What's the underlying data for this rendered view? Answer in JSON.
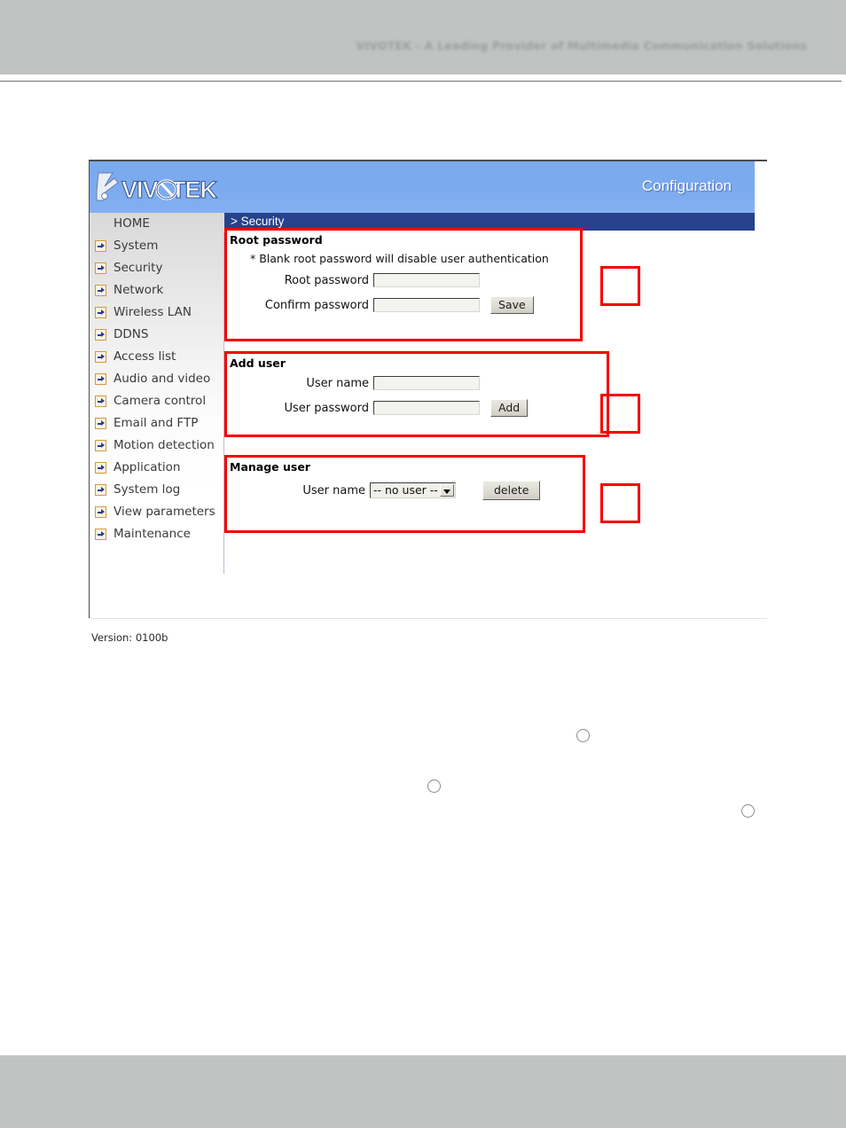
{
  "page": {
    "top_tagline": "VIVOTEK - A Leading Provider of Multimedia Communication Solutions"
  },
  "banner": {
    "brand": "VIVOTEK",
    "title": "Configuration"
  },
  "page_title": "> Security",
  "sidebar": {
    "home_label": "HOME",
    "items": [
      {
        "label": "System"
      },
      {
        "label": "Security"
      },
      {
        "label": "Network"
      },
      {
        "label": "Wireless LAN"
      },
      {
        "label": "DDNS"
      },
      {
        "label": "Access list"
      },
      {
        "label": "Audio and video"
      },
      {
        "label": "Camera control"
      },
      {
        "label": "Email and FTP"
      },
      {
        "label": "Motion detection"
      },
      {
        "label": "Application"
      },
      {
        "label": "System log"
      },
      {
        "label": "View parameters"
      },
      {
        "label": "Maintenance"
      }
    ],
    "version": "Version: 0100b"
  },
  "root_password": {
    "heading": "Root password",
    "note": "* Blank root password will disable user authentication",
    "root_label": "Root password",
    "root_value": "",
    "confirm_label": "Confirm password",
    "confirm_value": "",
    "save_label": "Save"
  },
  "add_user": {
    "heading": "Add user",
    "name_label": "User name",
    "name_value": "",
    "password_label": "User password",
    "password_value": "",
    "add_label": "Add"
  },
  "manage_user": {
    "heading": "Manage user",
    "name_label": "User name",
    "selected_user": "-- no user --",
    "options": [
      "-- no user --"
    ],
    "delete_label": "delete"
  },
  "colors": {
    "annotation_red": "#f60000",
    "banner_blue": "#7dabef",
    "title_bar_blue": "#26428c",
    "band_gray": "#c0c3c2"
  }
}
